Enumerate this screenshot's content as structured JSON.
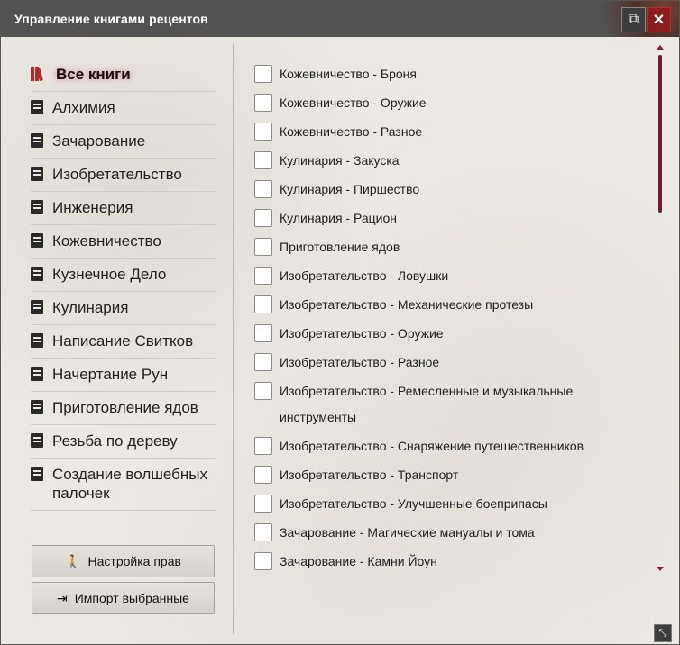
{
  "window": {
    "title": "Управление книгами рецентов"
  },
  "titlebar": {
    "popout_icon": "⧉",
    "close_icon": "✕"
  },
  "sidebar": {
    "items": [
      {
        "label": "Все книги",
        "icon": "books-icon",
        "active": true
      },
      {
        "label": "Алхимия",
        "icon": "book-icon"
      },
      {
        "label": "Зачарование",
        "icon": "book-icon"
      },
      {
        "label": "Изобретательство",
        "icon": "book-icon"
      },
      {
        "label": "Инженерия",
        "icon": "book-icon"
      },
      {
        "label": "Кожевничество",
        "icon": "book-icon"
      },
      {
        "label": "Кузнечное Дело",
        "icon": "book-icon"
      },
      {
        "label": "Кулинария",
        "icon": "book-icon"
      },
      {
        "label": "Написание Свитков",
        "icon": "book-icon"
      },
      {
        "label": "Начертание Рун",
        "icon": "book-icon"
      },
      {
        "label": "Приготовление ядов",
        "icon": "book-icon"
      },
      {
        "label": "Резьба по дереву",
        "icon": "book-icon"
      },
      {
        "label": "Создание волшебных палочек",
        "icon": "book-icon"
      }
    ],
    "buttons": {
      "permissions": {
        "label": "Настройка прав",
        "icon": "person-icon",
        "glyph": "🚶"
      },
      "import": {
        "label": "Импорт выбранные",
        "icon": "import-icon",
        "glyph": "⇥"
      }
    }
  },
  "recipes": [
    {
      "label": "Кожевничество - Броня",
      "checked": false
    },
    {
      "label": "Кожевничество - Оружие",
      "checked": false
    },
    {
      "label": "Кожевничество - Разное",
      "checked": false
    },
    {
      "label": "Кулинария - Закуска",
      "checked": false
    },
    {
      "label": "Кулинария - Пиршество",
      "checked": false
    },
    {
      "label": "Кулинария - Рацион",
      "checked": false
    },
    {
      "label": "Приготовление ядов",
      "checked": false
    },
    {
      "label": "Изобретательство - Ловушки",
      "checked": false
    },
    {
      "label": "Изобретательство - Механические протезы",
      "checked": false
    },
    {
      "label": "Изобретательство - Оружие",
      "checked": false
    },
    {
      "label": "Изобретательство - Разное",
      "checked": false
    },
    {
      "label": "Изобретательство - Ремесленные и музыкальные инструменты",
      "checked": false
    },
    {
      "label": "Изобретательство - Снаряжение путешественников",
      "checked": false
    },
    {
      "label": "Изобретательство - Транспорт",
      "checked": false
    },
    {
      "label": "Изобретательство - Улучшенные боеприпасы",
      "checked": false
    },
    {
      "label": "Зачарование - Магические мануалы и тома",
      "checked": false
    },
    {
      "label": "Зачарование - Камни Йоун",
      "checked": false
    }
  ],
  "colors": {
    "accent": "#8b1e2a",
    "close": "#8b1e1e",
    "titlebar": "#525252"
  }
}
